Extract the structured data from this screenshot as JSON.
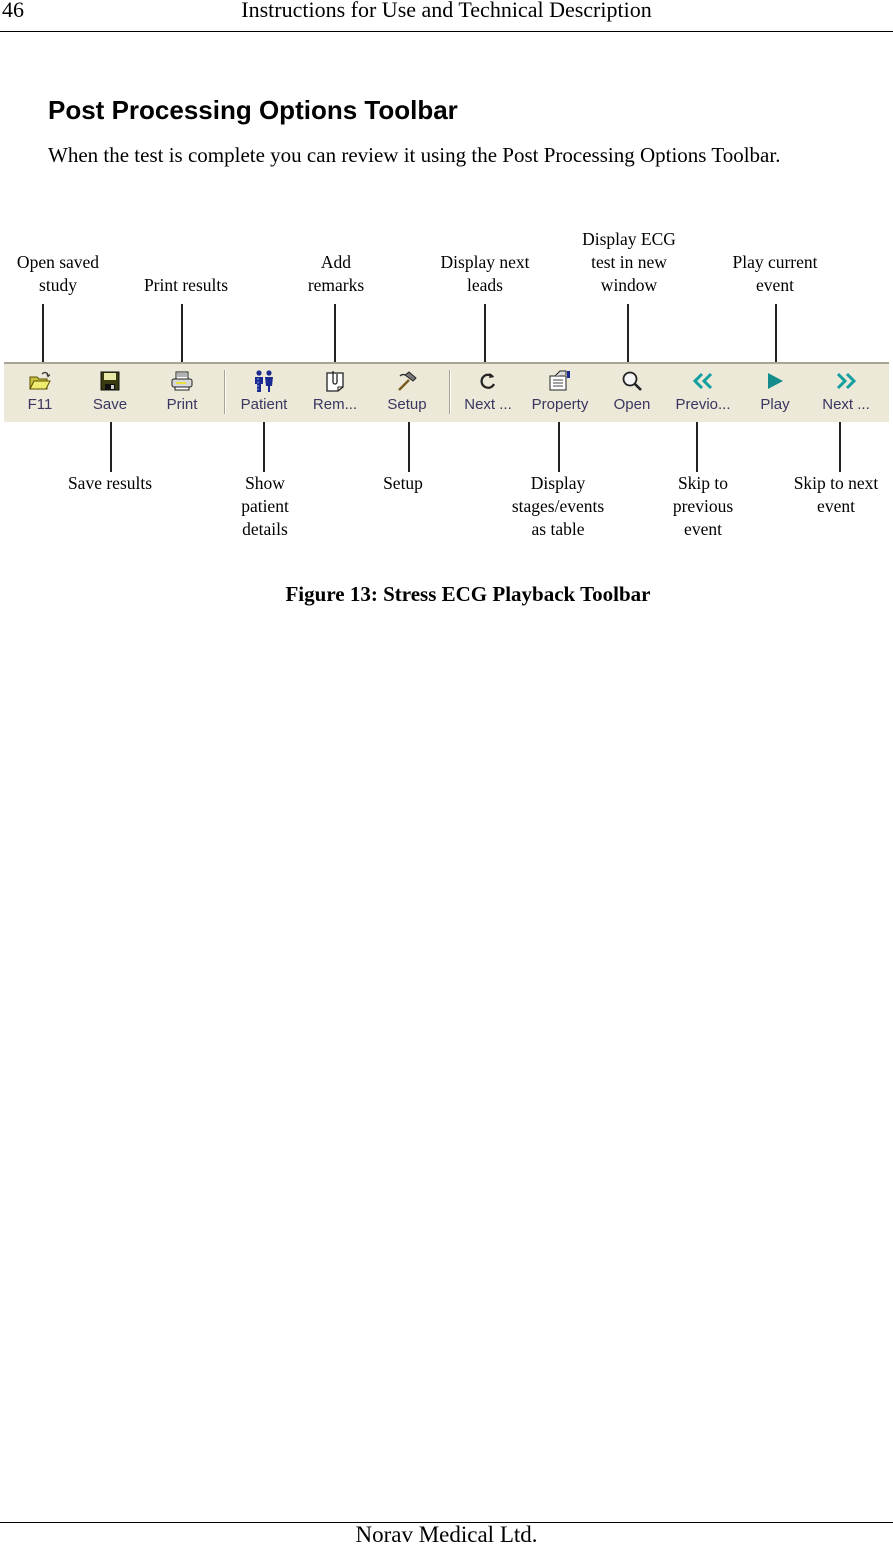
{
  "header": {
    "page_number": "46",
    "running_head": "Instructions for Use and Technical Description"
  },
  "section": {
    "title": "Post Processing Options Toolbar",
    "intro": "When the test is complete you can review it using the Post Processing Options Toolbar."
  },
  "toolbar": {
    "background": "#ece9d8",
    "label_color": "#3b3561",
    "buttons": [
      {
        "id": "f11",
        "icon": "open-folder-icon",
        "label": "F11"
      },
      {
        "id": "save",
        "icon": "floppy-disk-icon",
        "label": "Save"
      },
      {
        "id": "print",
        "icon": "printer-icon",
        "label": "Print"
      },
      {
        "id": "patient",
        "icon": "patient-icon",
        "label": "Patient"
      },
      {
        "id": "remarks",
        "icon": "remarks-clip-icon",
        "label": "Rem..."
      },
      {
        "id": "setup",
        "icon": "hammer-icon",
        "label": "Setup"
      },
      {
        "id": "next-leads",
        "icon": "refresh-icon",
        "label": "Next ..."
      },
      {
        "id": "property",
        "icon": "property-icon",
        "label": "Property"
      },
      {
        "id": "open",
        "icon": "magnifier-icon",
        "label": "Open"
      },
      {
        "id": "previous",
        "icon": "double-chevron-left-icon",
        "label": "Previo..."
      },
      {
        "id": "play",
        "icon": "play-icon",
        "label": "Play"
      },
      {
        "id": "next-event",
        "icon": "double-chevron-right-icon",
        "label": "Next ..."
      }
    ]
  },
  "callouts_top": [
    {
      "target": "f11",
      "text": "Open saved\nstudy"
    },
    {
      "target": "print",
      "text": "Print results"
    },
    {
      "target": "remarks",
      "text": "Add\nremarks"
    },
    {
      "target": "next-leads",
      "text": "Display next\nleads"
    },
    {
      "target": "open",
      "text": "Display ECG\ntest in new\nwindow"
    },
    {
      "target": "play",
      "text": "Play current\nevent"
    }
  ],
  "callouts_bottom": [
    {
      "target": "save",
      "text": "Save results"
    },
    {
      "target": "patient",
      "text": "Show\npatient\ndetails"
    },
    {
      "target": "setup",
      "text": "Setup"
    },
    {
      "target": "property",
      "text": "Display\nstages/events\nas table"
    },
    {
      "target": "previous",
      "text": "Skip to\nprevious\nevent"
    },
    {
      "target": "next-event",
      "text": "Skip to next\nevent"
    }
  ],
  "figure": {
    "caption": "Figure 13: Stress ECG Playback Toolbar"
  },
  "footer": {
    "company": "Norav Medical Ltd."
  }
}
